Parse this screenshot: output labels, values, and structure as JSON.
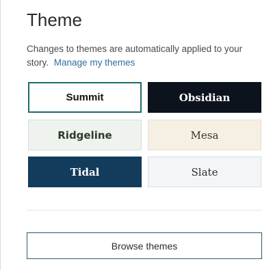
{
  "panel": {
    "title": "Theme",
    "description": "Changes to themes are automatically applied to your story.",
    "manage_link": "Manage my themes"
  },
  "themes": [
    {
      "label": "Summit",
      "selected": true
    },
    {
      "label": "Obsidian"
    },
    {
      "label": "Ridgeline"
    },
    {
      "label": "Mesa"
    },
    {
      "label": "Tidal"
    },
    {
      "label": "Slate"
    }
  ],
  "browse_button": {
    "label": "Browse themes"
  },
  "colors": {
    "accent_border": "#1f6b6b",
    "link": "#2f6f9f",
    "obsidian_bg": "#0c131c",
    "tidal_bg": "#133b5c",
    "ridgeline_bg": "#eef3ee",
    "mesa_bg": "#f6efe3",
    "slate_bg": "#f3f5f6"
  }
}
